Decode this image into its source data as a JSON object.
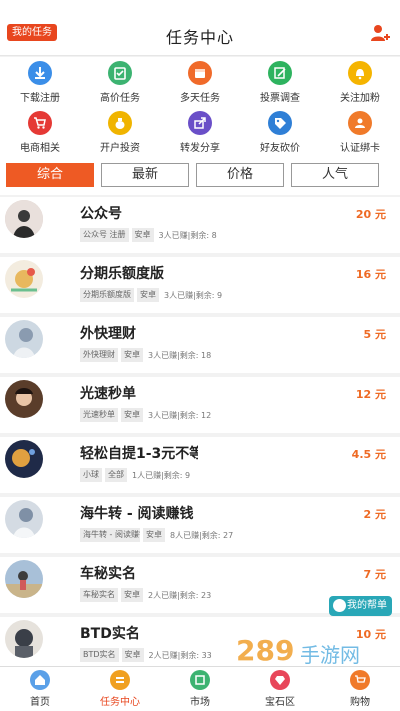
{
  "header": {
    "my_task_label": "我的任务",
    "title": "任务中心",
    "user_icon": "user-plus-icon"
  },
  "categories": [
    {
      "label": "下载注册",
      "icon": "download-icon",
      "color": "#3b8ee8"
    },
    {
      "label": "高价任务",
      "icon": "clipboard-check-icon",
      "color": "#3cb371"
    },
    {
      "label": "多天任务",
      "icon": "calendar-icon",
      "color": "#f06a2a"
    },
    {
      "label": "投票调查",
      "icon": "pencil-note-icon",
      "color": "#2eb35f"
    },
    {
      "label": "关注加粉",
      "icon": "bell-icon",
      "color": "#f5b400"
    },
    {
      "label": "电商相关",
      "icon": "cart-icon",
      "color": "#e53935"
    },
    {
      "label": "开户投资",
      "icon": "money-bag-icon",
      "color": "#f0b400"
    },
    {
      "label": "转发分享",
      "icon": "share-icon",
      "color": "#6a4fc8"
    },
    {
      "label": "好友砍价",
      "icon": "tag-icon",
      "color": "#2f7fd6"
    },
    {
      "label": "认证绑卡",
      "icon": "person-card-icon",
      "color": "#f07a2a"
    }
  ],
  "tabs": [
    {
      "label": "综合",
      "active": true
    },
    {
      "label": "最新",
      "active": false
    },
    {
      "label": "价格",
      "active": false
    },
    {
      "label": "人气",
      "active": false
    }
  ],
  "tasks": [
    {
      "name": "公众号",
      "price": "20 元",
      "tag1": "公众号 注册",
      "tag2": "安卓",
      "stats": "3人已赚|剩余: 8",
      "avatar_color": "#d9c9c2"
    },
    {
      "name": "分期乐额度版",
      "price": "16 元",
      "tag1": "分期乐额度版",
      "tag2": "安卓",
      "stats": "3人已赚|剩余: 9",
      "avatar_color": "#e8d2b8"
    },
    {
      "name": "外快理财",
      "price": "5 元",
      "tag1": "外快理财",
      "tag2": "安卓",
      "stats": "3人已赚|剩余: 18",
      "avatar_color": "#c7d3de"
    },
    {
      "name": "光速秒单",
      "price": "12 元",
      "tag1": "光速秒单",
      "tag2": "安卓",
      "stats": "3人已赚|剩余: 12",
      "avatar_color": "#6b4a33"
    },
    {
      "name": "轻松自提1-3元不等",
      "price": "4.5 元",
      "tag1": "小球",
      "tag2": "全部",
      "stats": "1人已赚|剩余: 9",
      "avatar_color": "#2b3a5a"
    },
    {
      "name": "海牛转 - 阅读赚钱",
      "price": "2 元",
      "tag1": "海牛转 - 阅读赚钱",
      "tag2": "安卓",
      "stats": "8人已赚|剩余: 27",
      "avatar_color": "#c9d2dc"
    },
    {
      "name": "车秘实名",
      "price": "7 元",
      "tag1": "车秘实名",
      "tag2": "安卓",
      "stats": "2人已赚|剩余: 23",
      "avatar_color": "#8fa8c4"
    },
    {
      "name": "BTD实名",
      "price": "10 元",
      "tag1": "BTD实名",
      "tag2": "安卓",
      "stats": "2人已赚|剩余: 33",
      "avatar_color": "#4a4f58"
    }
  ],
  "float_button": {
    "label": "我的帮单",
    "icon": "helper-icon"
  },
  "watermark": {
    "text": "手游网",
    "number": "289"
  },
  "bottom_nav": [
    {
      "label": "首页",
      "icon": "home-icon",
      "color": "#5aa0e8",
      "active": false
    },
    {
      "label": "任务中心",
      "icon": "task-icon",
      "color": "#f0a020",
      "active": true
    },
    {
      "label": "市场",
      "icon": "market-icon",
      "color": "#3cb371",
      "active": false
    },
    {
      "label": "宝石区",
      "icon": "gem-icon",
      "color": "#e8465a",
      "active": false
    },
    {
      "label": "购物",
      "icon": "cart-icon",
      "color": "#f07a2a",
      "active": false
    }
  ]
}
